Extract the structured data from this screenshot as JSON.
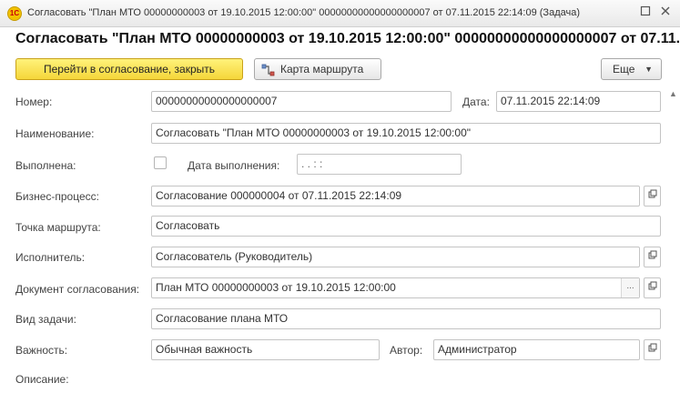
{
  "window": {
    "title": "Согласовать \"План МТО 00000000003 от 19.10.2015 12:00:00\" 00000000000000000007 от 07.11.2015 22:14:09 (Задача)",
    "logo_text": "1C"
  },
  "page": {
    "title": "Согласовать \"План МТО 00000000003 от 19.10.2015 12:00:00\" 00000000000000000007 от 07.11.2015 22:14:09"
  },
  "toolbar": {
    "primary_label": "Перейти в согласование, закрыть",
    "route_map_label": "Карта маршрута",
    "more_label": "Еще"
  },
  "form": {
    "number_label": "Номер:",
    "number_value": "00000000000000000007",
    "date_label": "Дата:",
    "date_value": "07.11.2015 22:14:09",
    "name_label": "Наименование:",
    "name_value": "Согласовать \"План МТО 00000000003 от 19.10.2015 12:00:00\"",
    "completed_label": "Выполнена:",
    "completion_date_label": "Дата выполнения:",
    "completion_date_value": " .  .      :  :",
    "business_process_label": "Бизнес-процесс:",
    "business_process_value": "Согласование 000000004 от 07.11.2015 22:14:09",
    "route_point_label": "Точка маршрута:",
    "route_point_value": "Согласовать",
    "executor_label": "Исполнитель:",
    "executor_value": "Согласователь (Руководитель)",
    "approval_document_label": "Документ согласования:",
    "approval_document_value": "План МТО 00000000003 от 19.10.2015 12:00:00",
    "task_type_label": "Вид задачи:",
    "task_type_value": "Согласование плана МТО",
    "importance_label": "Важность:",
    "importance_value": "Обычная важность",
    "author_label": "Автор:",
    "author_value": "Администратор",
    "description_label": "Описание:"
  }
}
